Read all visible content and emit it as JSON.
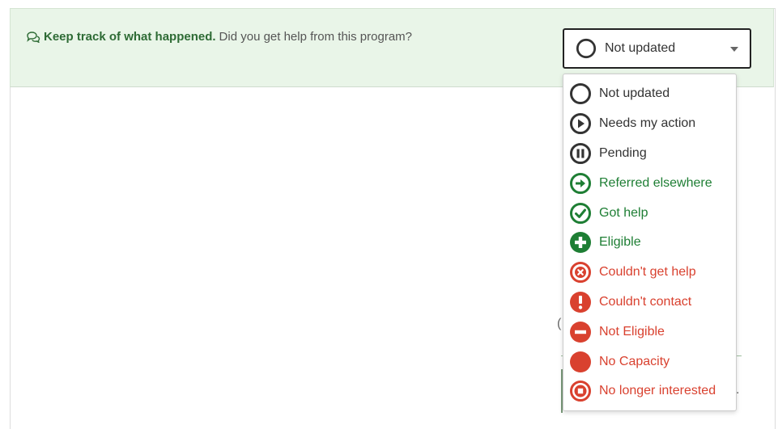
{
  "prompt": {
    "strong": "Keep track of what happened.",
    "rest": "Did you get help from this program?"
  },
  "select": {
    "selected_label": "Not updated"
  },
  "options": [
    {
      "label": "Not updated",
      "icon": "circle-outline-icon",
      "tone": "dark"
    },
    {
      "label": "Needs my action",
      "icon": "play-circle-icon",
      "tone": "dark"
    },
    {
      "label": "Pending",
      "icon": "pause-circle-icon",
      "tone": "dark"
    },
    {
      "label": "Referred elsewhere",
      "icon": "arrow-right-circle-icon",
      "tone": "green"
    },
    {
      "label": "Got help",
      "icon": "check-circle-icon",
      "tone": "green"
    },
    {
      "label": "Eligible",
      "icon": "plus-circle-icon",
      "tone": "green"
    },
    {
      "label": "Couldn't get help",
      "icon": "x-circle-icon",
      "tone": "red"
    },
    {
      "label": "Couldn't contact",
      "icon": "exclamation-circle-icon",
      "tone": "red"
    },
    {
      "label": "Not Eligible",
      "icon": "minus-circle-icon",
      "tone": "red"
    },
    {
      "label": "No Capacity",
      "icon": "filled-circle-icon",
      "tone": "red"
    },
    {
      "label": "No longer interested",
      "icon": "stop-circle-icon",
      "tone": "red"
    }
  ],
  "colors": {
    "dark": "#333333",
    "green": "#1e7e34",
    "red": "#d9412f",
    "header_bg": "#e9f5e8"
  }
}
